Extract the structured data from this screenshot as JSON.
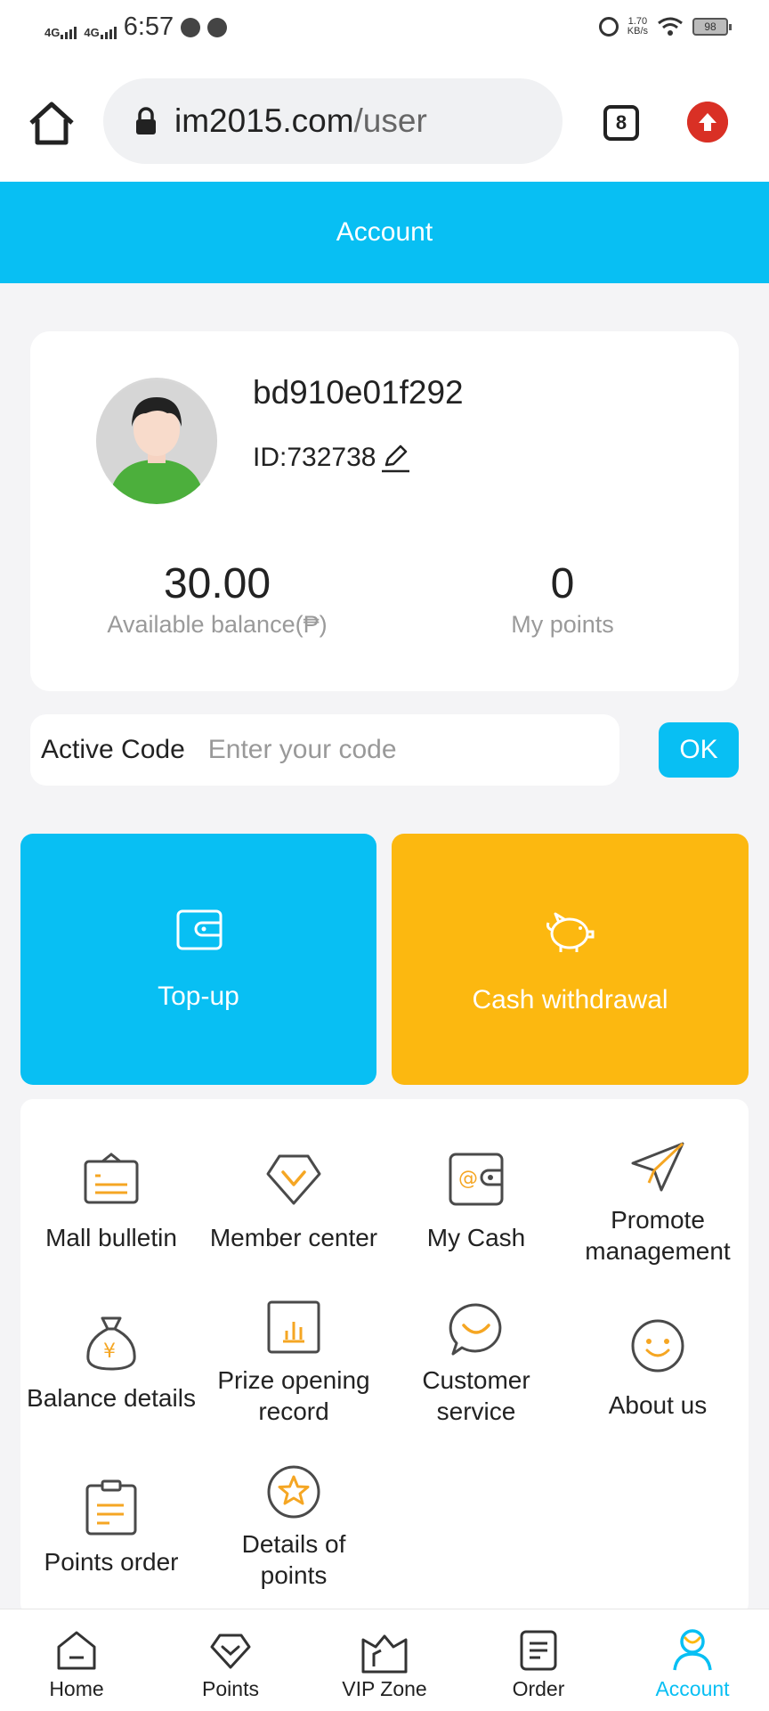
{
  "status_bar": {
    "network1": "4G",
    "network2": "4G",
    "time": "6:57",
    "speed_value": "1.70",
    "speed_unit": "KB/s",
    "battery": "98"
  },
  "browser": {
    "url_domain": "im2015.com",
    "url_path": "/user",
    "tab_count": "8"
  },
  "header": {
    "title": "Account"
  },
  "profile": {
    "username": "bd910e01f292",
    "id_text": "ID:732738",
    "balance_value": "30.00",
    "balance_label": "Available balance(₱)",
    "points_value": "0",
    "points_label": "My points"
  },
  "active_code": {
    "label": "Active Code",
    "placeholder": "Enter your code",
    "ok_label": "OK"
  },
  "actions": {
    "topup_label": "Top-up",
    "cash_label": "Cash withdrawal"
  },
  "menu": {
    "items": [
      {
        "label": "Mall bulletin",
        "icon": "bulletin-board-icon"
      },
      {
        "label": "Member center",
        "icon": "diamond-icon"
      },
      {
        "label": "My Cash",
        "icon": "wallet-icon"
      },
      {
        "label_line1": "Promote",
        "label_line2": "management",
        "icon": "paper-plane-icon"
      },
      {
        "label": "Balance details",
        "icon": "money-bag-icon"
      },
      {
        "label_line1": "Prize opening",
        "label_line2": "record",
        "icon": "bar-chart-icon"
      },
      {
        "label_line1": "Customer",
        "label_line2": "service",
        "icon": "chat-bubble-icon"
      },
      {
        "label": "About us",
        "icon": "smile-icon"
      },
      {
        "label": "Points order",
        "icon": "clipboard-icon"
      },
      {
        "label_line1": "Details of",
        "label_line2": "points",
        "icon": "star-icon"
      }
    ]
  },
  "bottom_nav": {
    "items": [
      {
        "label": "Home",
        "icon": "home-icon"
      },
      {
        "label": "Points",
        "icon": "diamond-icon"
      },
      {
        "label": "VIP Zone",
        "icon": "crown-box-icon"
      },
      {
        "label": "Order",
        "icon": "document-icon"
      },
      {
        "label": "Account",
        "icon": "person-icon"
      }
    ],
    "active": "Account"
  },
  "colors": {
    "primary": "#08bff3",
    "accent_orange": "#fcb810",
    "icon_stroke": "#4a4a4a",
    "icon_accent": "#f5a623"
  }
}
